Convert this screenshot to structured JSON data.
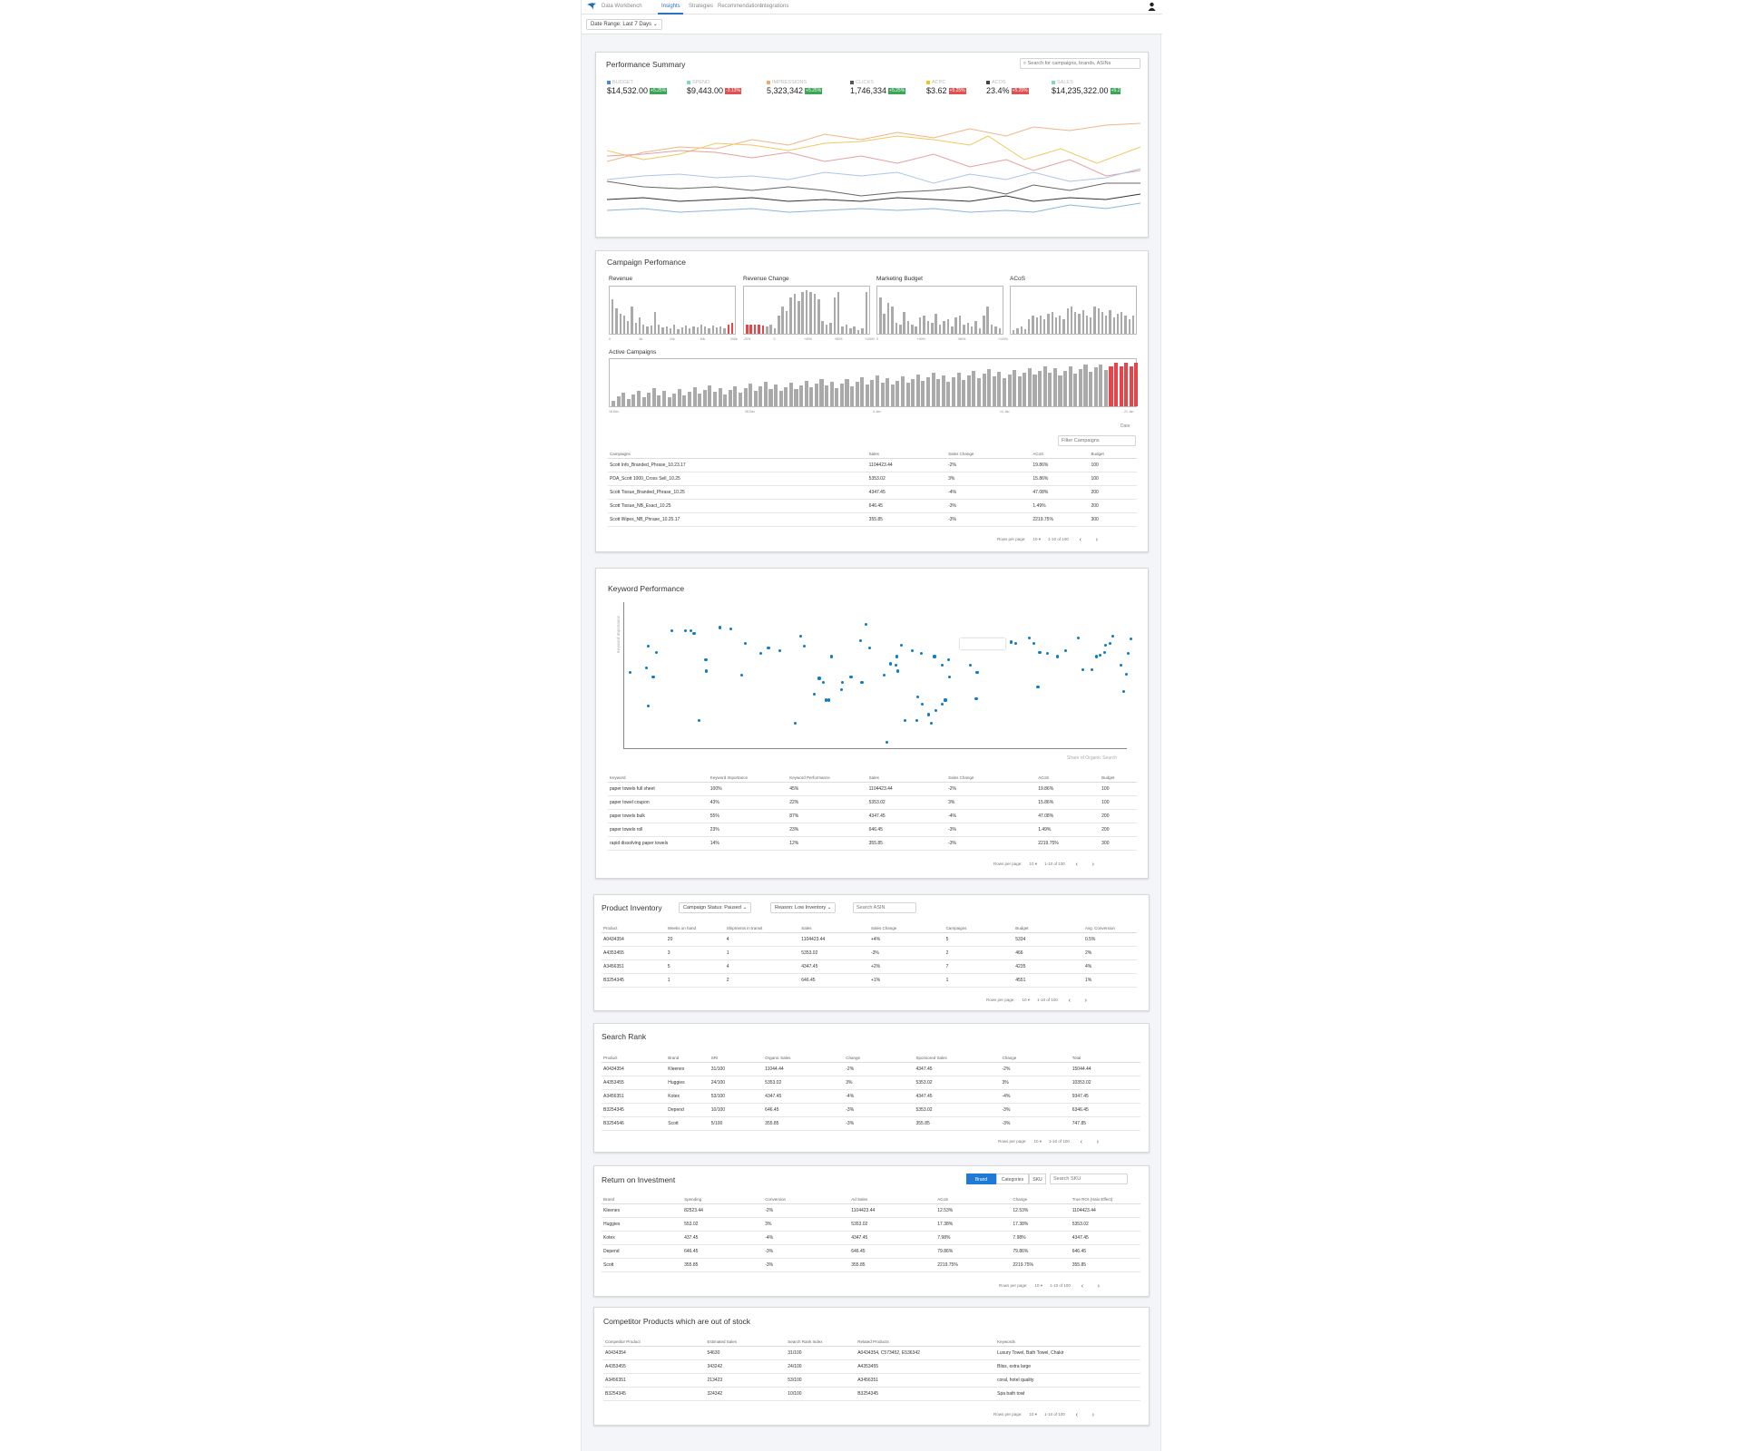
{
  "nav": {
    "tabs": [
      "Data Workbench",
      "Insights",
      "Strategies",
      "Recommendations",
      "Integrations"
    ],
    "active": "Insights",
    "date_range": "Date Range: Last 7 Days"
  },
  "perf_summary": {
    "title": "Performance Summary",
    "search_placeholder": "Search for campaigns, brands, ASINs",
    "metrics": [
      {
        "label": "BUDGET",
        "value": "$14,532.00",
        "change": "+5.25%",
        "dir": "up",
        "color": "#4a86e8"
      },
      {
        "label": "SPEND",
        "value": "$9,443.00",
        "change": "-3.13%",
        "dir": "down",
        "color": "#7ed6c6"
      },
      {
        "label": "IMPRESSIONS",
        "value": "5,323,342",
        "change": "+5.25%",
        "dir": "up",
        "color": "#f2a96b"
      },
      {
        "label": "CLICKS",
        "value": "1,746,334",
        "change": "+5.25%",
        "dir": "up",
        "color": "#555555"
      },
      {
        "label": "ACPC",
        "value": "$3.62",
        "change": "+5.25%",
        "dir": "down",
        "color": "#f0c419"
      },
      {
        "label": "ACOS",
        "value": "23.4%",
        "change": "+5.25%",
        "dir": "down",
        "color": "#444444"
      },
      {
        "label": "SALES",
        "value": "$14,235,322.00",
        "change": "+5.2",
        "dir": "up",
        "color": "#7ed6c6"
      }
    ]
  },
  "campaign": {
    "title": "Campaign Perfomance",
    "minis": [
      {
        "title": "Revenue",
        "ticks": [
          "0",
          "5k",
          "10k",
          "30k",
          "200k"
        ]
      },
      {
        "title": "Revenue Change",
        "ticks": [
          "-20%",
          "0",
          "+40%",
          "+80%",
          "+100%"
        ]
      },
      {
        "title": "Marketing Budget",
        "ticks": [
          "0",
          "+40%",
          "+80%",
          "+100%"
        ]
      },
      {
        "title": "ACoS",
        "ticks": []
      }
    ],
    "active_title": "Active Campaigns",
    "active_ticks": [
      "18 Dec",
      "28 Dec",
      "4 Jan",
      "14 Jan",
      "21 Jan"
    ],
    "date_label": "Date",
    "filter_placeholder": "Filter Campaigns",
    "columns": [
      "Campaigns",
      "Sales",
      "Sales Change",
      "ACoS",
      "Budget"
    ],
    "rows": [
      [
        "Scott Info_Branded_Phrase_10.23.17",
        "1104423.44",
        "-2%",
        "19.86%",
        "100"
      ],
      [
        "PDA_Scott 1000_Cross Sell_10.25",
        "5353.02",
        "3%",
        "15.86%",
        "100"
      ],
      [
        "Scott Tissue_Branded_Phrase_10.25",
        "4347.45",
        "-4%",
        "47.08%",
        "200"
      ],
      [
        "Scott Tissue_NB_Exact_10.25",
        "646.45",
        "-3%",
        "1.49%",
        "200"
      ],
      [
        "Scott Wipes_NB_Phrase_10.25.17",
        "355.85",
        "-3%",
        "2219.75%",
        "300"
      ]
    ],
    "pager": {
      "rpp_label": "Rows per page:",
      "rpp": "10",
      "range": "1-10 of 100"
    }
  },
  "keyword": {
    "title": "Keyword Performance",
    "y_label": "Keyword Importance",
    "x_label": "Share of Organic Search",
    "columns": [
      "Keyword",
      "Keyword Importance",
      "Keyword Performance",
      "Sales",
      "Sales Change",
      "ACoS",
      "Budget"
    ],
    "rows": [
      [
        "paper towels full sheet",
        "100%",
        "45%",
        "1104423.44",
        "-2%",
        "19.86%",
        "100"
      ],
      [
        "paper towel coupon",
        "43%",
        "22%",
        "5353.02",
        "3%",
        "15.86%",
        "100"
      ],
      [
        "paper towels bulk",
        "55%",
        "87%",
        "4347.45",
        "-4%",
        "47.08%",
        "200"
      ],
      [
        "paper towels roll",
        "23%",
        "23%",
        "646.45",
        "-3%",
        "1.49%",
        "200"
      ],
      [
        "rapid dissolving paper towels",
        "14%",
        "12%",
        "355.85",
        "-3%",
        "2219.75%",
        "300"
      ]
    ],
    "pager": {
      "rpp_label": "Rows per page:",
      "rpp": "10",
      "range": "1-10 of 100"
    }
  },
  "inventory": {
    "title": "Product Inventory",
    "status_filter": "Campaign Status: Paused",
    "reason_filter": "Reason: Low Inventory",
    "search_placeholder": "Search ASIN",
    "columns": [
      "Product",
      "Weeks on hand",
      "Shipments in transit",
      "Sales",
      "Sales Change",
      "Campaigns",
      "Budget",
      "Avg. Conversion"
    ],
    "rows": [
      [
        "A0434354",
        "20",
        "4",
        "1104423.44",
        "+4%",
        "5",
        "5334",
        "0.5%"
      ],
      [
        "A4353455",
        "3",
        "1",
        "5353.02",
        "-3%",
        "2",
        "466",
        "2%"
      ],
      [
        "A3456351",
        "5",
        "4",
        "4347.45",
        "+2%",
        "7",
        "4235",
        "4%"
      ],
      [
        "B3254345",
        "1",
        "2",
        "646.45",
        "+1%",
        "1",
        "4551",
        "1%"
      ]
    ],
    "pager": {
      "rpp_label": "Rows per page:",
      "rpp": "10",
      "range": "1-10 of 100"
    }
  },
  "search_rank": {
    "title": "Search Rank",
    "columns": [
      "Product",
      "Brand",
      "SRI",
      "Organic Sales",
      "Change",
      "Sponsored Sales",
      "Change",
      "Total"
    ],
    "rows": [
      [
        "A0434354",
        "Kleenex",
        "31/100",
        "11044.44",
        "-2%",
        "4347.45",
        "-2%",
        "15044.44"
      ],
      [
        "A4353455",
        "Huggies",
        "24/100",
        "5353.02",
        "3%",
        "5353.02",
        "3%",
        "10353.02"
      ],
      [
        "A3456351",
        "Kotex",
        "53/100",
        "4347.45",
        "-4%",
        "4347.45",
        "-4%",
        "9347.45"
      ],
      [
        "B3254345",
        "Depend",
        "10/100",
        "646.45",
        "-3%",
        "5353.02",
        "-3%",
        "6346.45"
      ],
      [
        "B3254546",
        "Scott",
        "5/100",
        "355.85",
        "-3%",
        "355.85",
        "-3%",
        "747.85"
      ]
    ],
    "pager": {
      "rpp_label": "Rows per page:",
      "rpp": "10",
      "range": "1-10 of 100"
    }
  },
  "roi": {
    "title": "Return on Investment",
    "seg": [
      "Brand",
      "Categories",
      "SKU"
    ],
    "search_placeholder": "Search SKU",
    "columns": [
      "Brand",
      "Spending",
      "Conversion",
      "Ad Sales",
      "ACoS",
      "Change",
      "True ROI (Halo Effect)"
    ],
    "rows": [
      [
        "Kleenex",
        "82523.44",
        "-2%",
        "1104423.44",
        "12.53%",
        "12.53%",
        "1104423.44"
      ],
      [
        "Huggies",
        "553.02",
        "3%",
        "5353.02",
        "17.38%",
        "17.38%",
        "5353.02"
      ],
      [
        "Kotex",
        "437.45",
        "-4%",
        "4347.45",
        "7.98%",
        "7.98%",
        "4347.45"
      ],
      [
        "Depend",
        "646.45",
        "-3%",
        "646.45",
        "79.86%",
        "79.86%",
        "646.45"
      ],
      [
        "Scott",
        "355.85",
        "-3%",
        "355.85",
        "2219.75%",
        "2219.75%",
        "355.85"
      ]
    ],
    "pager": {
      "rpp_label": "Rows per page:",
      "rpp": "10",
      "range": "1-10 of 100"
    }
  },
  "competitor": {
    "title": "Competitor Products which are out of stock",
    "columns": [
      "Competitor Product",
      "Estimated Sales",
      "Search Rank Index",
      "Related Products",
      "Keywords"
    ],
    "rows": [
      [
        "A0434354",
        "54630",
        "31/100",
        "A0434354, C573452, E536342",
        "Luxury Towel, Bath Towel, Chakir"
      ],
      [
        "A4353455",
        "343242",
        "24/100",
        "A4353455",
        "Bliss, extra large"
      ],
      [
        "A3456351",
        "213423",
        "53/100",
        "A3456351",
        "coral, hotel quality"
      ],
      [
        "B3254345",
        "324342",
        "10/100",
        "B3254345",
        "Spa bath towl"
      ]
    ],
    "pager": {
      "rpp_label": "Rows per page:",
      "rpp": "10",
      "range": "1-10 of 100"
    }
  }
}
